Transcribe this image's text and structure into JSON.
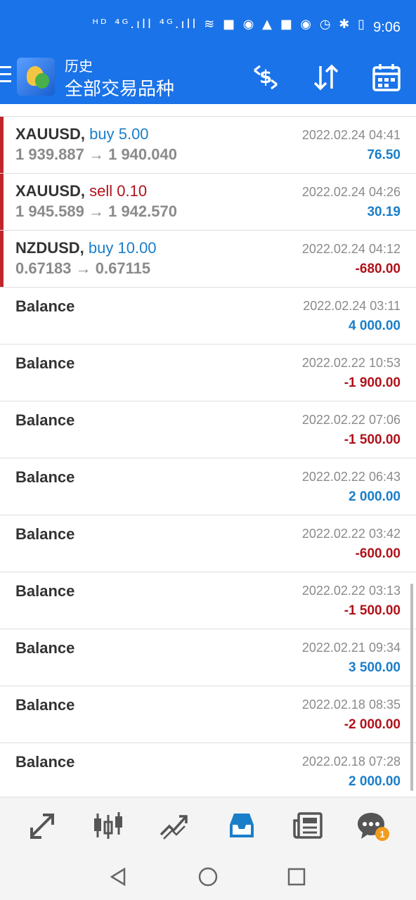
{
  "status_bar": {
    "time": "9:06",
    "icons_text": "ᴴᴰ ⁴ᴳ.ıll ⁴ᴳ.ıll ≋ ■ ◉ ▲ ■ ◉ ◷ ✱ ▯"
  },
  "header": {
    "section": "历史",
    "title": "全部交易品种"
  },
  "trades": [
    {
      "symbol": "XAUUSD,",
      "side": "buy 5.00",
      "side_color": "#1a7ec9",
      "prices": "1 939.887 → 1 940.040",
      "date": "2022.02.24 04:41",
      "profit": "76.50",
      "profit_color": "#1a7ec9"
    },
    {
      "symbol": "XAUUSD,",
      "side": "sell 0.10",
      "side_color": "#b0121a",
      "prices": "1 945.589 → 1 942.570",
      "date": "2022.02.24 04:26",
      "profit": "30.19",
      "profit_color": "#1a7ec9"
    },
    {
      "symbol": "NZDUSD,",
      "side": "buy 10.00",
      "side_color": "#1a7ec9",
      "prices": "0.67183 → 0.67115",
      "date": "2022.02.24 04:12",
      "profit": "-680.00",
      "profit_color": "#b0121a"
    }
  ],
  "balances": [
    {
      "label": "Balance",
      "date": "2022.02.24 03:11",
      "amount": "4 000.00",
      "color": "#1a7ec9"
    },
    {
      "label": "Balance",
      "date": "2022.02.22 10:53",
      "amount": "-1 900.00",
      "color": "#b0121a"
    },
    {
      "label": "Balance",
      "date": "2022.02.22 07:06",
      "amount": "-1 500.00",
      "color": "#b0121a"
    },
    {
      "label": "Balance",
      "date": "2022.02.22 06:43",
      "amount": "2 000.00",
      "color": "#1a7ec9"
    },
    {
      "label": "Balance",
      "date": "2022.02.22 03:42",
      "amount": "-600.00",
      "color": "#b0121a"
    },
    {
      "label": "Balance",
      "date": "2022.02.22 03:13",
      "amount": "-1 500.00",
      "color": "#b0121a"
    },
    {
      "label": "Balance",
      "date": "2022.02.21 09:34",
      "amount": "3 500.00",
      "color": "#1a7ec9"
    },
    {
      "label": "Balance",
      "date": "2022.02.18 08:35",
      "amount": "-2 000.00",
      "color": "#b0121a"
    },
    {
      "label": "Balance",
      "date": "2022.02.18 07:28",
      "amount": "2 000.00",
      "color": "#1a7ec9"
    }
  ],
  "bottom_nav": {
    "items": [
      "quotes-icon",
      "chart-icon",
      "trade-icon",
      "history-icon",
      "news-icon",
      "chat-icon"
    ],
    "active": "history-icon",
    "chat_badge": "1"
  },
  "colors": {
    "accent": "#1a73e8",
    "profit_positive": "#1a7ec9",
    "profit_negative": "#b0121a",
    "trade_marker": "#c0262d"
  }
}
